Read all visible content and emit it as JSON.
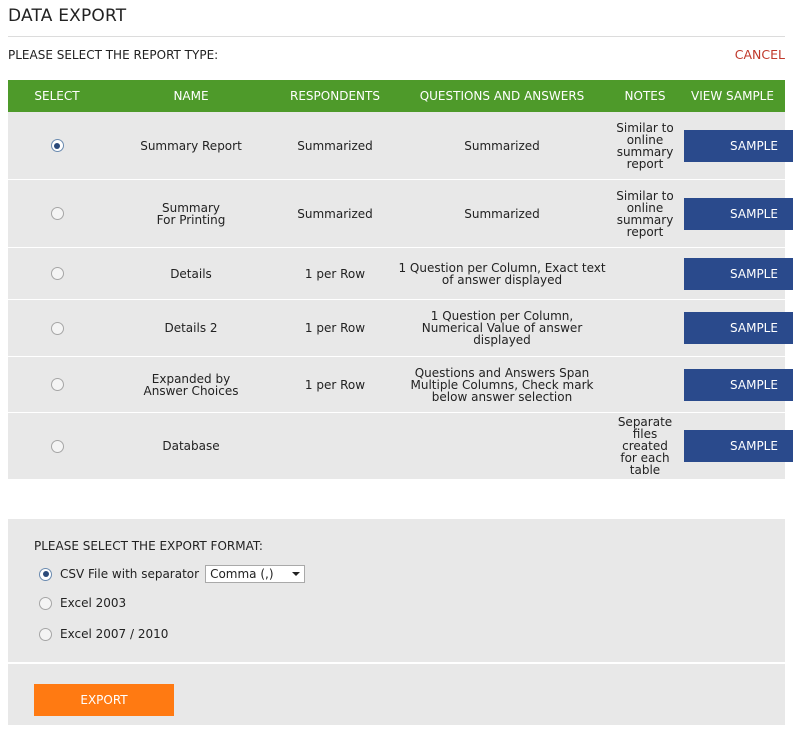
{
  "page": {
    "title": "DATA EXPORT"
  },
  "report_section": {
    "label": "PLEASE SELECT THE REPORT TYPE:",
    "cancel_label": "CANCEL",
    "columns": [
      "SELECT",
      "NAME",
      "RESPONDENTS",
      "QUESTIONS AND ANSWERS",
      "NOTES",
      "VIEW SAMPLE"
    ],
    "rows": [
      {
        "name": "Summary Report",
        "respondents": "Summarized",
        "qa": "Summarized",
        "notes": "Similar to\nonline\nsummary\nreport",
        "sample_label": "SAMPLE",
        "selected": true
      },
      {
        "name": "Summary\nFor Printing",
        "respondents": "Summarized",
        "qa": "Summarized",
        "notes": "Similar to\nonline\nsummary\nreport",
        "sample_label": "SAMPLE",
        "selected": false
      },
      {
        "name": "Details",
        "respondents": "1 per Row",
        "qa": "1 Question per Column, Exact text\nof answer displayed",
        "notes": "",
        "sample_label": "SAMPLE",
        "selected": false
      },
      {
        "name": "Details 2",
        "respondents": "1 per Row",
        "qa": "1 Question per Column,\nNumerical Value of answer\ndisplayed",
        "notes": "",
        "sample_label": "SAMPLE",
        "selected": false
      },
      {
        "name": "Expanded by\nAnswer Choices",
        "respondents": "1 per Row",
        "qa": "Questions and Answers Span\nMultiple Columns, Check mark\nbelow answer selection",
        "notes": "",
        "sample_label": "SAMPLE",
        "selected": false
      },
      {
        "name": "Database",
        "respondents": "",
        "qa": "",
        "notes": "Separate\nfiles created\nfor each\ntable",
        "sample_label": "SAMPLE",
        "selected": false
      }
    ]
  },
  "format_section": {
    "label": "PLEASE SELECT THE EXPORT FORMAT:",
    "options": [
      {
        "label": "CSV File with separator",
        "selected": true
      },
      {
        "label": "Excel 2003",
        "selected": false
      },
      {
        "label": "Excel 2007 / 2010",
        "selected": false
      }
    ],
    "separator_value": "Comma (,)"
  },
  "actions": {
    "export_label": "EXPORT"
  },
  "colors": {
    "header_green": "#4e9a2a",
    "sample_blue": "#2a4a8c",
    "export_orange": "#ff7a12",
    "cancel_red": "#c0392b"
  }
}
